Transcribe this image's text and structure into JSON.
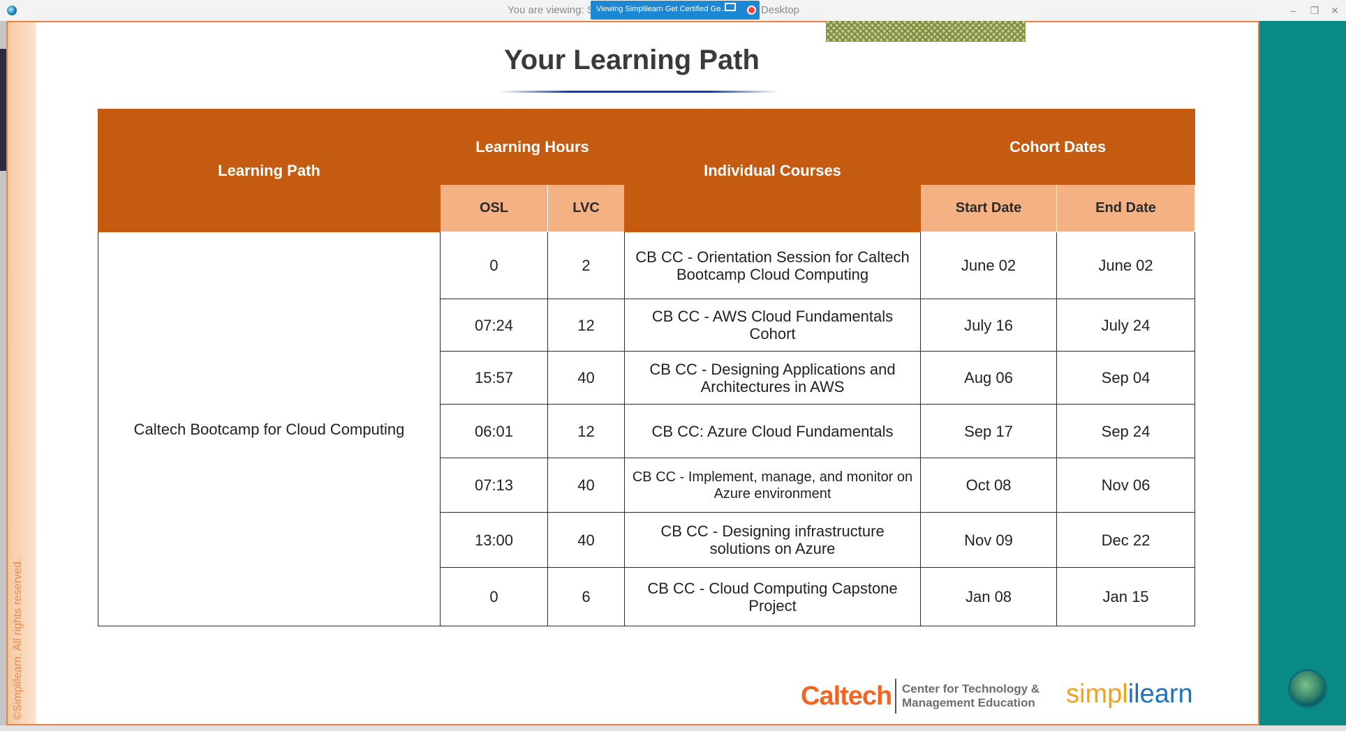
{
  "window": {
    "viewing_prefix": "You are viewing: S",
    "viewing_suffix": "Desktop",
    "share_label": "Viewing Simplilearn Get Certified Ge...",
    "minimize": "–",
    "maximize": "❐",
    "close": "✕"
  },
  "slide": {
    "title": "Your Learning Path",
    "copyright": "©Simplilearn. All rights reserved.",
    "headers": {
      "learning_path": "Learning Path",
      "learning_hours": "Learning Hours",
      "osl": "OSL",
      "lvc": "LVC",
      "individual_courses": "Individual Courses",
      "cohort_dates": "Cohort Dates",
      "start_date": "Start Date",
      "end_date": "End Date"
    },
    "learning_path_name": "Caltech Bootcamp for Cloud Computing",
    "rows": [
      {
        "osl": "0",
        "lvc": "2",
        "course": "CB CC - Orientation Session for Caltech Bootcamp Cloud Computing",
        "start": "June 02",
        "end": "June 02"
      },
      {
        "osl": "07:24",
        "lvc": "12",
        "course": "CB CC - AWS Cloud Fundamentals Cohort",
        "start": "July 16",
        "end": "July 24"
      },
      {
        "osl": "15:57",
        "lvc": "40",
        "course": "CB CC - Designing Applications and Architectures in AWS",
        "start": "Aug 06",
        "end": "Sep 04"
      },
      {
        "osl": "06:01",
        "lvc": "12",
        "course": "CB CC: Azure Cloud Fundamentals",
        "start": "Sep 17",
        "end": "Sep 24"
      },
      {
        "osl": "07:13",
        "lvc": "40",
        "course": "CB CC - Implement, manage, and monitor on Azure environment",
        "start": "Oct 08",
        "end": "Nov 06"
      },
      {
        "osl": "13:00",
        "lvc": "40",
        "course": "CB CC - Designing infrastructure solutions on Azure",
        "start": "Nov 09",
        "end": "Dec 22"
      },
      {
        "osl": "0",
        "lvc": "6",
        "course": "CB CC - Cloud Computing Capstone Project",
        "start": "Jan 08",
        "end": "Jan 15"
      }
    ],
    "logos": {
      "caltech": "Caltech",
      "caltech_sub_line1": "Center for Technology &",
      "caltech_sub_line2": "Management Education",
      "simplilearn_a": "simpl",
      "simplilearn_b": "ilearn"
    }
  },
  "colors": {
    "header_dark": "#c55a11",
    "header_light": "#f4b183",
    "frame_border": "#f08040",
    "teal_panel": "#0a8a86"
  }
}
